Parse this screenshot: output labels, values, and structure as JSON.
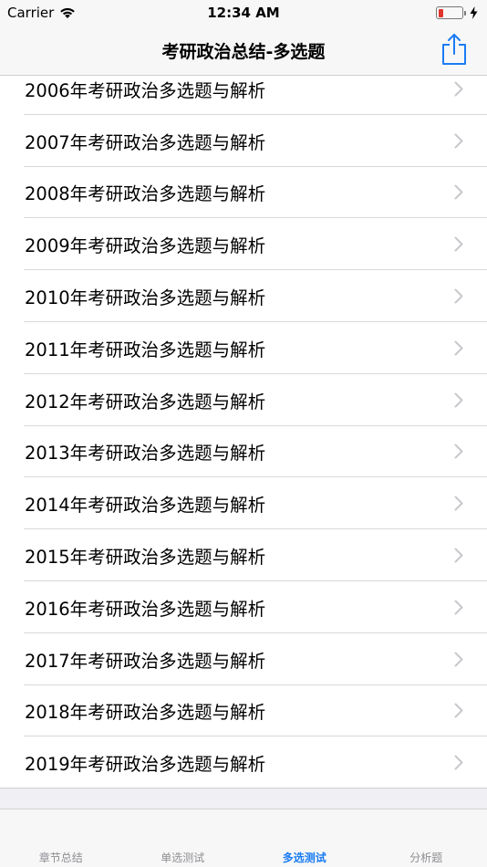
{
  "status": {
    "carrier": "Carrier",
    "time": "12:34 AM",
    "battery_color": "#e0332a"
  },
  "nav": {
    "title": "考研政治总结-多选题",
    "share_icon": "share-icon",
    "accent": "#1a7cf4"
  },
  "list": {
    "items": [
      {
        "label": "2006年考研政治多选题与解析"
      },
      {
        "label": "2007年考研政治多选题与解析"
      },
      {
        "label": "2008年考研政治多选题与解析"
      },
      {
        "label": "2009年考研政治多选题与解析"
      },
      {
        "label": "2010年考研政治多选题与解析"
      },
      {
        "label": "2011年考研政治多选题与解析"
      },
      {
        "label": "2012年考研政治多选题与解析"
      },
      {
        "label": "2013年考研政治多选题与解析"
      },
      {
        "label": "2014年考研政治多选题与解析"
      },
      {
        "label": "2015年考研政治多选题与解析"
      },
      {
        "label": "2016年考研政治多选题与解析"
      },
      {
        "label": "2017年考研政治多选题与解析"
      },
      {
        "label": "2018年考研政治多选题与解析"
      },
      {
        "label": "2019年考研政治多选题与解析"
      }
    ]
  },
  "tabbar": {
    "tabs": [
      {
        "label": "章节总结",
        "active": false
      },
      {
        "label": "单选测试",
        "active": false
      },
      {
        "label": "多选测试",
        "active": true
      },
      {
        "label": "分析题",
        "active": false
      }
    ]
  }
}
